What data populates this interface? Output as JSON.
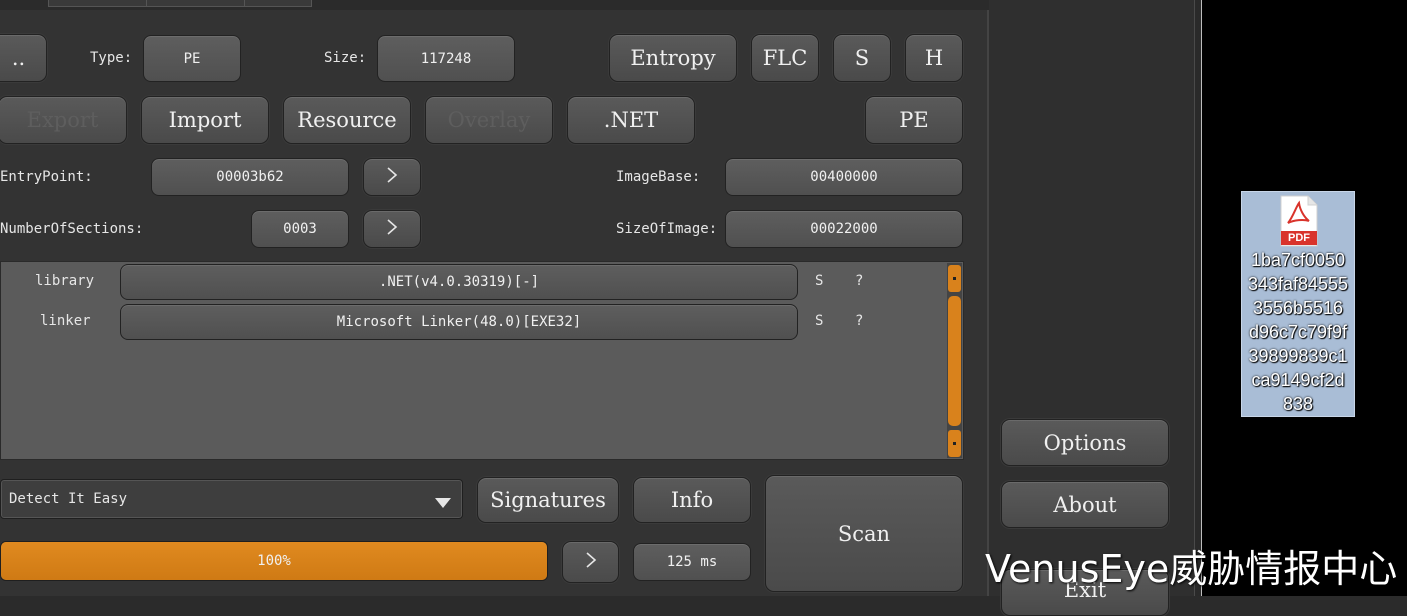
{
  "file_info": {
    "browse_label": "..",
    "type_label": "Type:",
    "type_value": "PE",
    "size_label": "Size:",
    "size_value": "117248",
    "entropy_label": "Entropy",
    "flc_label": "FLC",
    "s_label": "S",
    "h_label": "H"
  },
  "pe_buttons": {
    "export_label": "Export",
    "import_label": "Import",
    "resource_label": "Resource",
    "overlay_label": "Overlay",
    "net_label": ".NET",
    "pe_label": "PE"
  },
  "headers": {
    "entrypoint_label": "EntryPoint:",
    "entrypoint_value": "00003b62",
    "imagebase_label": "ImageBase:",
    "imagebase_value": "00400000",
    "numsections_label": "NumberOfSections:",
    "numsections_value": "0003",
    "sizeofimage_label": "SizeOfImage:",
    "sizeofimage_value": "00022000"
  },
  "results": [
    {
      "type": "library",
      "value": ".NET(v4.0.30319)[-]",
      "s": "S",
      "q": "?"
    },
    {
      "type": "linker",
      "value": "Microsoft Linker(48.0)[EXE32]",
      "s": "S",
      "q": "?"
    }
  ],
  "bottom": {
    "engine_selected": "Detect It Easy",
    "signatures_label": "Signatures",
    "info_label": "Info",
    "scan_label": "Scan",
    "progress_text": "100%",
    "progress_value": 1.0,
    "time_value": "125 ms"
  },
  "side": {
    "options_label": "Options",
    "about_label": "About",
    "exit_label": "Exit"
  },
  "desktop": {
    "file_label": "1ba7cf0050343faf845553556b5516d96c7c79f939899839c1ca9149cf2d838",
    "file_label_lines": [
      "1ba7cf0050",
      "343faf84555",
      "3556b5516",
      "d96c7c79f9f",
      "39899839c1",
      "ca9149cf2d",
      "838"
    ],
    "pdf_badge": "PDF",
    "icon": "pdf-file-icon"
  },
  "watermark": "VenusEye威胁情报中心",
  "colors": {
    "accent": "#d9821c",
    "background": "#2b2b2b",
    "panel": "#333333",
    "list_bg": "#5b5b5b",
    "selection": "#a9bdd6"
  }
}
